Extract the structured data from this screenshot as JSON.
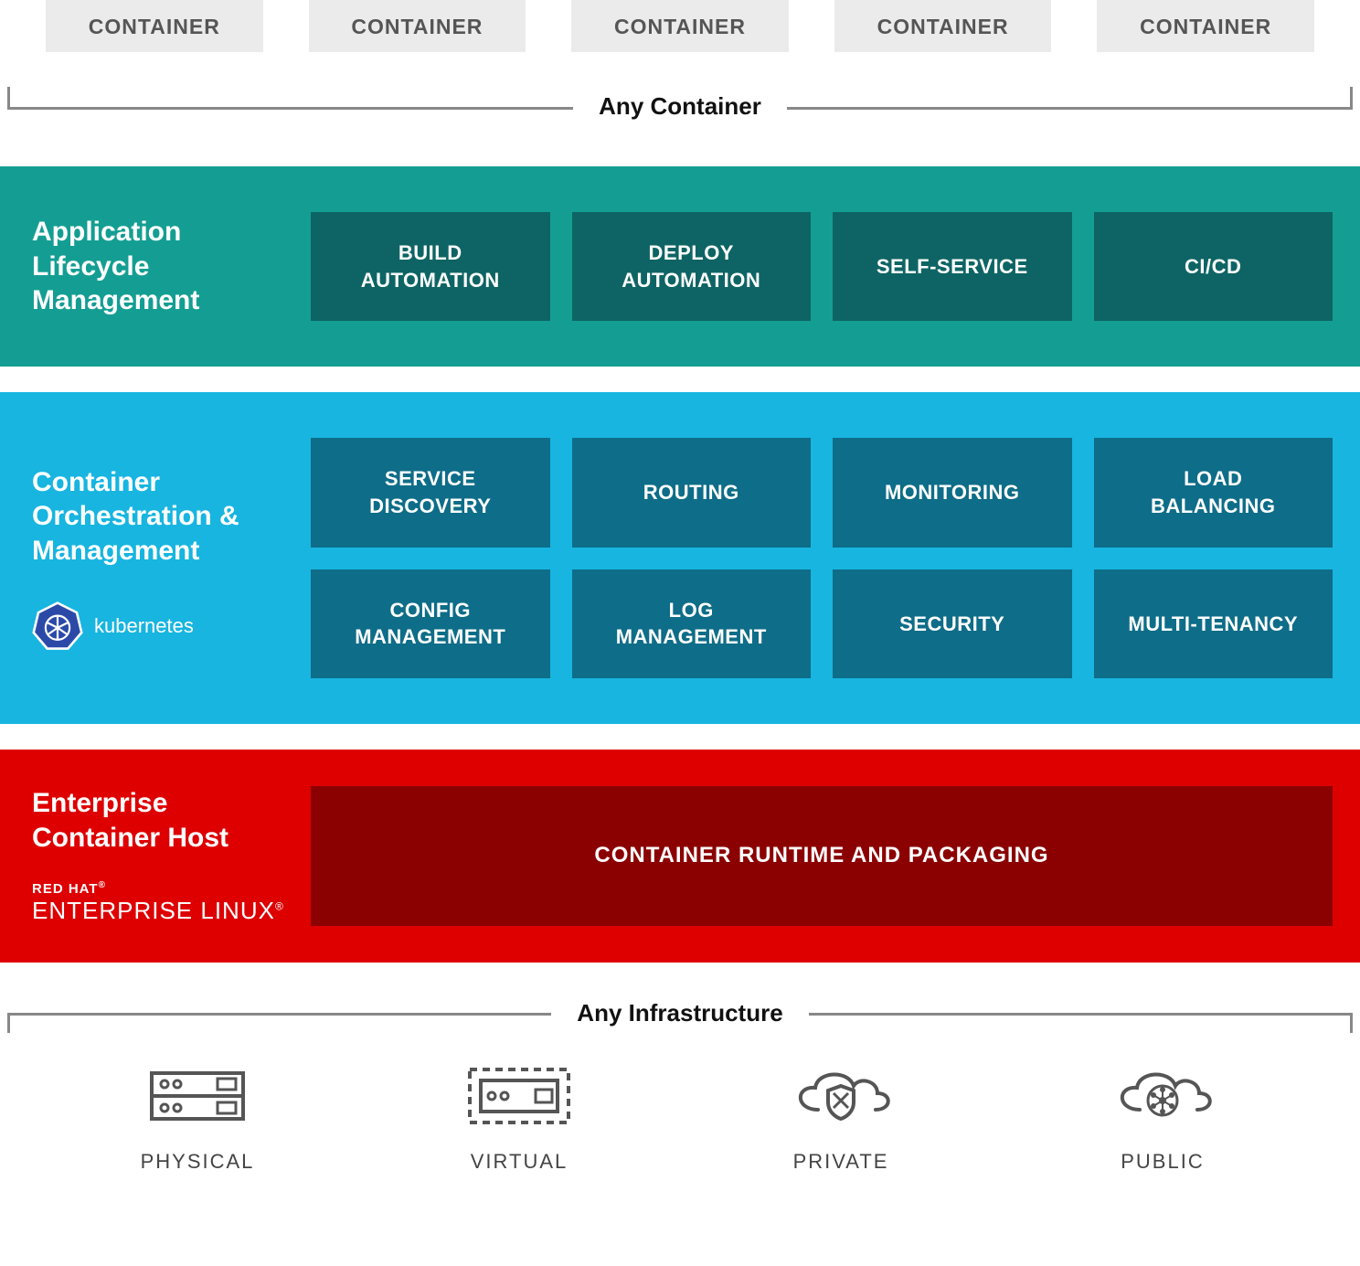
{
  "top": {
    "containers": [
      "CONTAINER",
      "CONTAINER",
      "CONTAINER",
      "CONTAINER",
      "CONTAINER"
    ],
    "bracket_label": "Any Container"
  },
  "layers": {
    "alm": {
      "title": "Application Lifecycle Management",
      "tiles": [
        "BUILD AUTOMATION",
        "DEPLOY AUTOMATION",
        "SELF-SERVICE",
        "CI/CD"
      ]
    },
    "orch": {
      "title": "Container Orchestration & Management",
      "brand": "kubernetes",
      "tiles_row1": [
        "SERVICE DISCOVERY",
        "ROUTING",
        "MONITORING",
        "LOAD BALANCING"
      ],
      "tiles_row2": [
        "CONFIG MANAGEMENT",
        "LOG MANAGEMENT",
        "SECURITY",
        "MULTI-TENANCY"
      ]
    },
    "host": {
      "title": "Enterprise Container Host",
      "brand_small": "RED HAT",
      "brand_big": "ENTERPRISE LINUX",
      "tile": "CONTAINER RUNTIME AND PACKAGING"
    }
  },
  "bottom": {
    "bracket_label": "Any Infrastructure",
    "items": [
      {
        "label": "PHYSICAL",
        "icon": "server-icon"
      },
      {
        "label": "VIRTUAL",
        "icon": "virtual-icon"
      },
      {
        "label": "PRIVATE",
        "icon": "cloud-shield-icon"
      },
      {
        "label": "PUBLIC",
        "icon": "cloud-network-icon"
      }
    ]
  }
}
